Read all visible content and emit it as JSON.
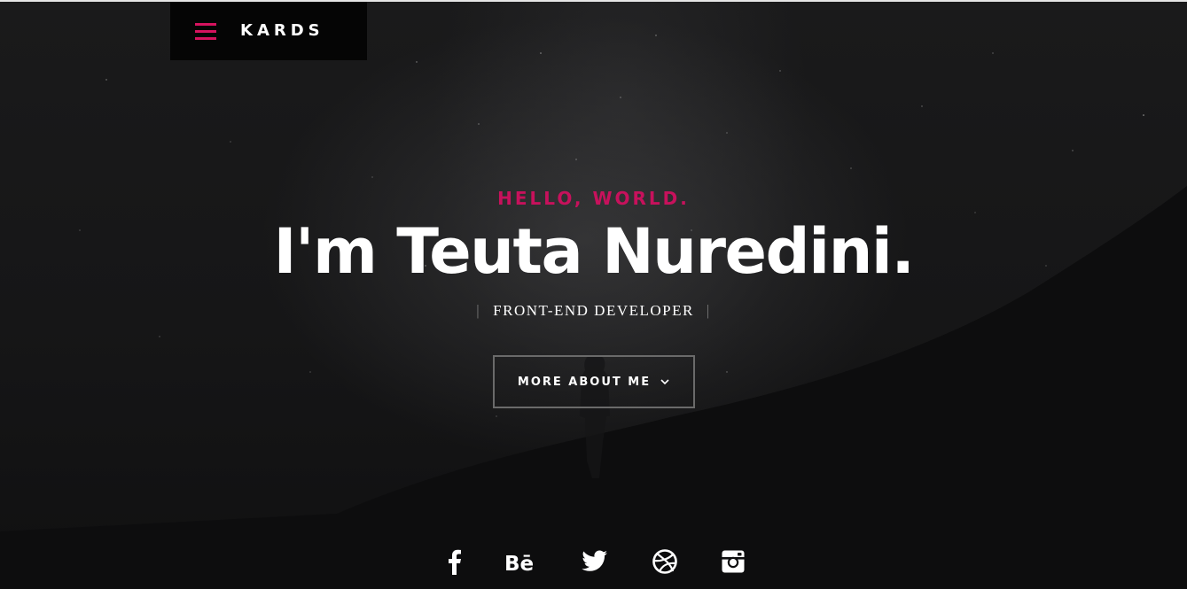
{
  "header": {
    "logo_text": "KARDS",
    "menu_icon": "hamburger-icon",
    "accent_color": "#d6135f"
  },
  "intro": {
    "greeting": "HELLO, WORLD.",
    "name": "I'm Teuta Nuredini.",
    "role": "FRONT-END DEVELOPER",
    "more_button": {
      "label": "MORE ABOUT ME",
      "icon": "chevron-down-icon"
    }
  },
  "social": {
    "links": [
      {
        "name": "facebook",
        "icon": "facebook-icon"
      },
      {
        "name": "behance",
        "icon": "behance-icon"
      },
      {
        "name": "twitter",
        "icon": "twitter-icon"
      },
      {
        "name": "dribbble",
        "icon": "dribbble-icon"
      },
      {
        "name": "instagram",
        "icon": "instagram-icon"
      }
    ]
  },
  "colors": {
    "background": "#0f0f10",
    "greeting": "#c7115c",
    "text": "#ffffff"
  }
}
